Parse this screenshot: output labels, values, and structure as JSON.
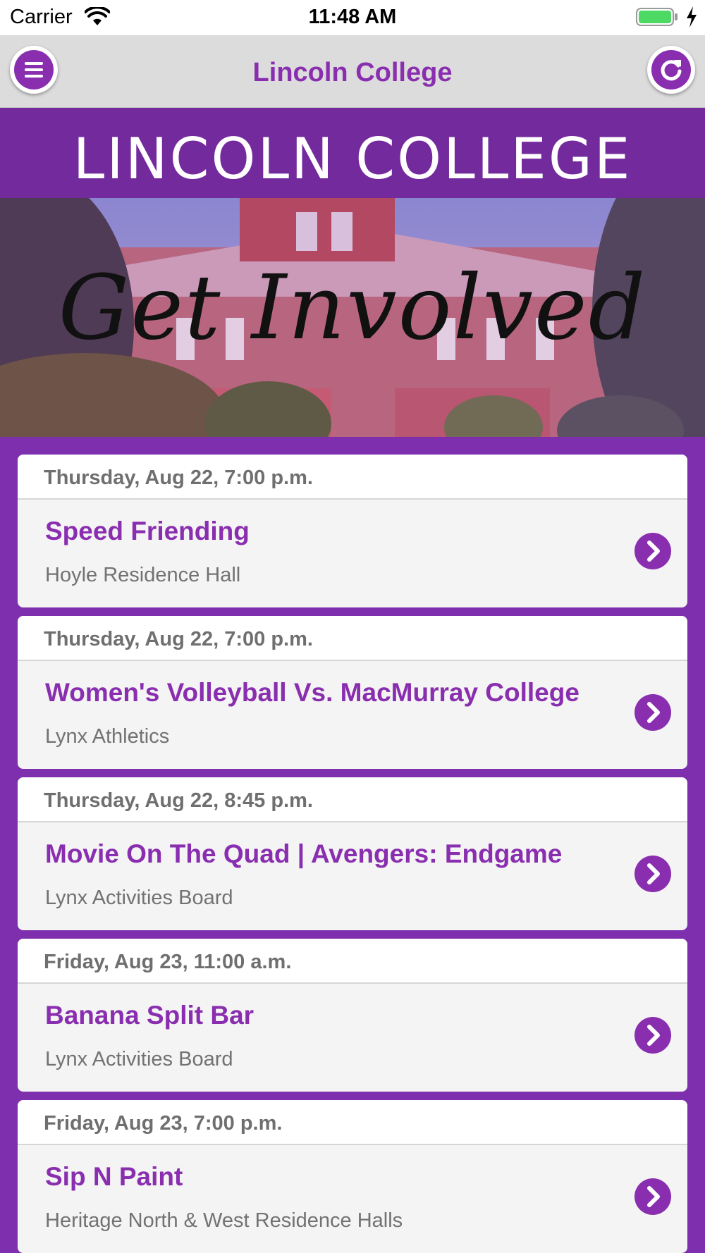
{
  "status_bar": {
    "carrier": "Carrier",
    "time": "11:48 AM",
    "battery_color": "#4cd964"
  },
  "nav": {
    "title": "Lincoln College",
    "menu_icon": "menu-icon",
    "refresh_icon": "refresh-icon"
  },
  "banner": {
    "brand": "LINCOLN COLLEGE",
    "headline": "Get Involved"
  },
  "colors": {
    "accent": "#8a2eb0",
    "background": "#7e2fae",
    "date_text": "#6f6f6f",
    "location_text": "#727272"
  },
  "events": [
    {
      "date": "Thursday, Aug 22, 7:00 p.m.",
      "title": "Speed Friending",
      "location": "Hoyle Residence Hall"
    },
    {
      "date": "Thursday, Aug 22, 7:00 p.m.",
      "title": "Women's Volleyball Vs. MacMurray College",
      "location": "Lynx Athletics"
    },
    {
      "date": "Thursday, Aug 22, 8:45 p.m.",
      "title": "Movie On The Quad | Avengers: Endgame",
      "location": "Lynx Activities Board"
    },
    {
      "date": "Friday, Aug 23, 11:00 a.m.",
      "title": "Banana Split Bar",
      "location": "Lynx Activities Board"
    },
    {
      "date": "Friday, Aug 23, 7:00 p.m.",
      "title": "Sip N Paint",
      "location": "Heritage North & West Residence Halls"
    }
  ]
}
